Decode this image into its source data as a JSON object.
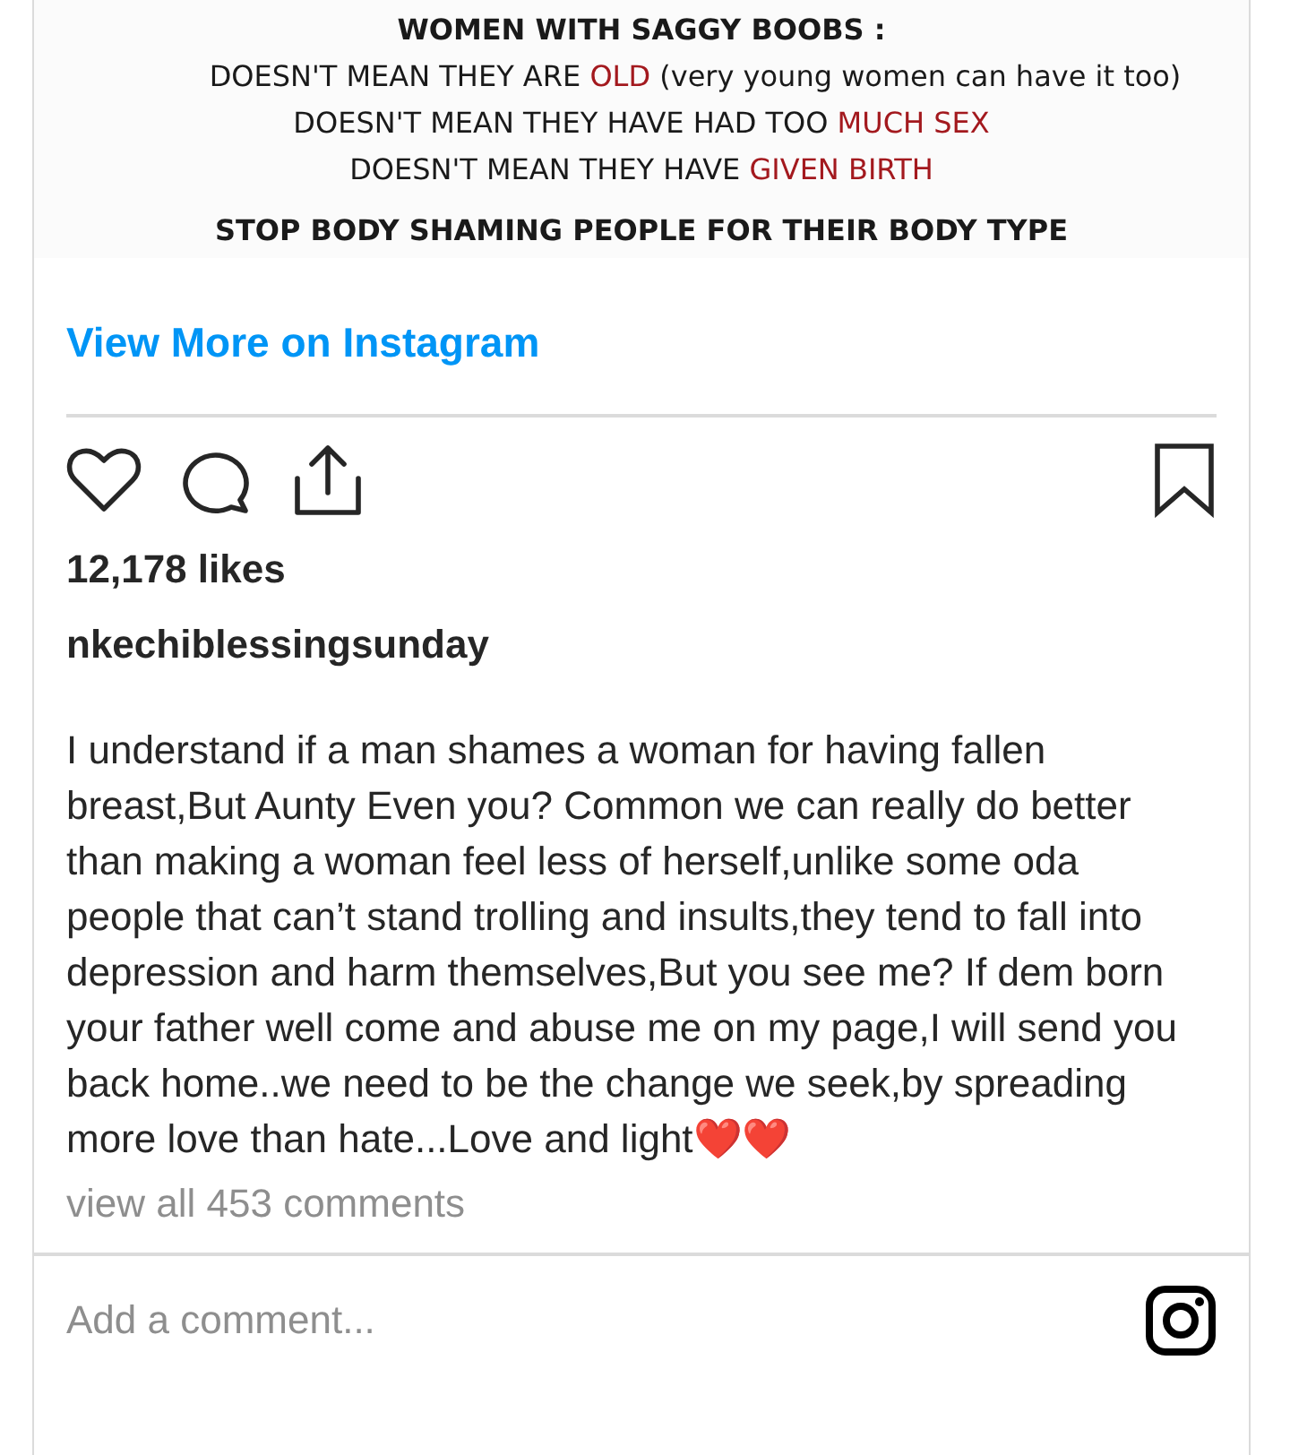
{
  "post_image": {
    "lines": [
      {
        "kind": "heading",
        "segments": [
          {
            "text": "WOMEN WITH SAGGY BOOBS :",
            "highlight": false
          }
        ]
      },
      {
        "kind": "body",
        "segments": [
          {
            "text": "DOESN'T MEAN THEY ARE ",
            "highlight": false
          },
          {
            "text": "OLD",
            "highlight": true
          },
          {
            "text": " (very young women can have it too)",
            "highlight": false
          }
        ]
      },
      {
        "kind": "body",
        "segments": [
          {
            "text": "DOESN'T MEAN THEY HAVE HAD TOO ",
            "highlight": false
          },
          {
            "text": "MUCH SEX",
            "highlight": true
          }
        ]
      },
      {
        "kind": "body",
        "segments": [
          {
            "text": "DOESN'T MEAN THEY HAVE ",
            "highlight": false
          },
          {
            "text": "GIVEN BIRTH",
            "highlight": true
          }
        ]
      },
      {
        "kind": "heading",
        "segments": [
          {
            "text": "STOP BODY SHAMING PEOPLE FOR THEIR BODY TYPE",
            "highlight": false
          }
        ]
      }
    ]
  },
  "view_more_link": "View More on Instagram",
  "likes": "12,178 likes",
  "username": "nkechiblessingsunday",
  "caption": "I understand if a man shames a woman for having fallen breast,But Aunty Even you? Common we can really do better than making a woman feel less of herself,unlike some oda people that can’t stand trolling and insults,they tend to fall into depression and harm themselves,But you see me? If dem born your father well come and abuse me on my page,I will send you back home..we need to be the change we seek,by spreading more love than hate...Love and light❤️❤️",
  "view_comments": "view all 453 comments",
  "comment_field": {
    "placeholder": "Add a comment..."
  }
}
